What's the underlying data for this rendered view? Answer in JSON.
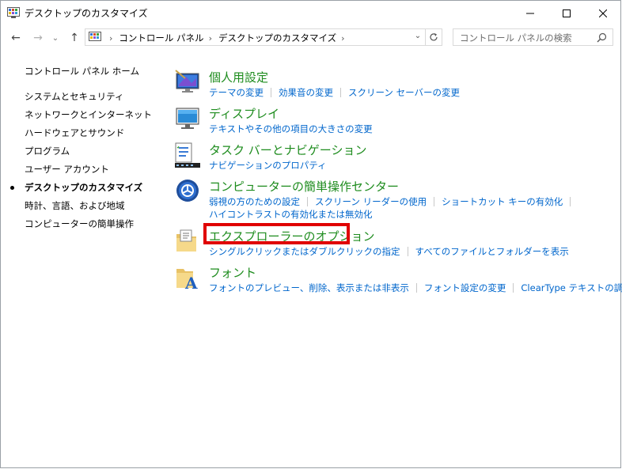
{
  "window": {
    "title": "デスクトップのカスタマイズ",
    "controls": {
      "minimize": "—",
      "maximize": "☐",
      "close": "✕"
    }
  },
  "nav": {
    "back": "←",
    "forward": "→",
    "recent": "⌄",
    "up": "↑",
    "breadcrumbs": [
      "コントロール パネル",
      "デスクトップのカスタマイズ"
    ],
    "search_placeholder": "コントロール パネルの検索"
  },
  "sidebar": {
    "items": [
      {
        "label": "コントロール パネル ホーム"
      },
      {
        "label": "システムとセキュリティ"
      },
      {
        "label": "ネットワークとインターネット"
      },
      {
        "label": "ハードウェアとサウンド"
      },
      {
        "label": "プログラム"
      },
      {
        "label": "ユーザー アカウント"
      },
      {
        "label": "デスクトップのカスタマイズ",
        "current": true
      },
      {
        "label": "時計、言語、および地域"
      },
      {
        "label": "コンピューターの簡単操作"
      }
    ]
  },
  "categories": [
    {
      "title": "個人用設定",
      "icon": "personalization-icon",
      "links": [
        [
          "テーマの変更",
          "効果音の変更",
          "スクリーン セーバーの変更"
        ]
      ]
    },
    {
      "title": "ディスプレイ",
      "icon": "display-icon",
      "links": [
        [
          "テキストやその他の項目の大きさの変更"
        ]
      ]
    },
    {
      "title": "タスク バーとナビゲーション",
      "icon": "taskbar-icon",
      "links": [
        [
          "ナビゲーションのプロパティ"
        ]
      ]
    },
    {
      "title": "コンピューターの簡単操作センター",
      "icon": "ease-of-access-icon",
      "links": [
        [
          "弱視の方のための設定",
          "スクリーン リーダーの使用",
          "ショートカット キーの有効化"
        ],
        [
          "ハイコントラストの有効化または無効化"
        ]
      ]
    },
    {
      "title": "エクスプローラーのオプション",
      "icon": "folder-options-icon",
      "links": [
        [
          "シングルクリックまたはダブルクリックの指定",
          "すべてのファイルとフォルダーを表示"
        ]
      ]
    },
    {
      "title": "フォント",
      "icon": "fonts-icon",
      "links": [
        [
          "フォントのプレビュー、削除、表示または非表示",
          "フォント設定の変更",
          "ClearType テキストの調整"
        ]
      ]
    }
  ],
  "colors": {
    "category_title": "#1e8c1e",
    "link": "#0066cc",
    "highlight": "#e00000"
  }
}
